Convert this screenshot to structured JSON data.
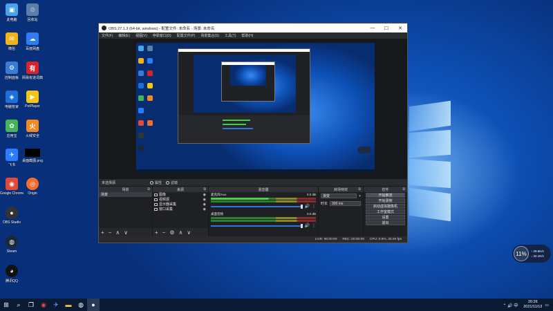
{
  "desktop": {
    "icons": [
      {
        "label": "此电脑",
        "color": "#4aa3e8",
        "glyph": "▣"
      },
      {
        "label": "微信",
        "color": "#2fb345",
        "glyph": "✉"
      },
      {
        "label": "控制面板",
        "color": "#3a7bd5",
        "glyph": "⚙"
      },
      {
        "label": "电脑管家",
        "color": "#1e6fd9",
        "glyph": "◈"
      },
      {
        "label": "应用宝",
        "color": "#46b35a",
        "glyph": "✿"
      },
      {
        "label": "飞书",
        "color": "#2b7cff",
        "glyph": "✈"
      },
      {
        "label": "Google Chrome",
        "color": "#e04a3a",
        "glyph": "◉"
      },
      {
        "label": "OBS Studio",
        "color": "#333333",
        "glyph": "●"
      },
      {
        "label": "Steam",
        "color": "#1b2838",
        "glyph": "◍"
      },
      {
        "label": "腾讯QQ",
        "color": "#111111",
        "glyph": "◕"
      }
    ],
    "icons_col2": [
      {
        "label": "回收站",
        "color": "#5b7fa6",
        "glyph": "♲"
      },
      {
        "label": "百度网盘",
        "color": "#2e7cf6",
        "glyph": "☁"
      },
      {
        "label": "网易有道词典",
        "color": "#d8232a",
        "glyph": "有"
      },
      {
        "label": "PotPlayer",
        "color": "#f5c518",
        "glyph": "▶"
      },
      {
        "label": "火绒安全",
        "color": "#f08a24",
        "glyph": "火"
      },
      {
        "label": "桌面截图.png",
        "color": "#000000",
        "glyph": ""
      },
      {
        "label": "Origin",
        "color": "#f56c2d",
        "glyph": "◎"
      }
    ]
  },
  "obs": {
    "title": "OBS 27.1.3 (64-bit, windows) - 配置文件: 未命名 - 场景: 未命名",
    "menu": [
      "文件(F)",
      "编辑(E)",
      "视图(V)",
      "停靠窗口(D)",
      "配置文件(P)",
      "场景集合(S)",
      "工具(T)",
      "帮助(H)"
    ],
    "scene_label": "未选择源",
    "props_label": "属性",
    "filters_label": "滤镜",
    "docks": {
      "scenes": {
        "title": "场景",
        "items": [
          "场景"
        ]
      },
      "sources": {
        "title": "来源",
        "items": [
          "图像",
          "视频源",
          "显示器采集",
          "窗口采集"
        ]
      },
      "mixer": {
        "title": "混音器",
        "channels": [
          {
            "name": "麦克风/Aux",
            "db": "0.0 dB"
          },
          {
            "name": "桌面音频",
            "db": "0.0 dB"
          }
        ]
      },
      "transitions": {
        "title": "转场特效",
        "type": "渐变",
        "duration_label": "时长",
        "duration": "300 ms"
      },
      "controls": {
        "title": "控件",
        "buttons": [
          "开始推流",
          "开始录制",
          "启动虚拟摄像机",
          "工作室模式",
          "设置",
          "退出"
        ]
      }
    },
    "status": {
      "live": "LIVE: 00:00:00",
      "rec": "REC: 00:00:00",
      "cpu": "CPU: 0.9%, 30.00 fps"
    }
  },
  "taskbar": {
    "time": "20:26",
    "date": "2021/11/13",
    "tray": "⌃ 🔊 中"
  },
  "widget": {
    "value": "11%",
    "up": "↑ 29.6K/s",
    "down": "↓ 32.1K/s"
  }
}
